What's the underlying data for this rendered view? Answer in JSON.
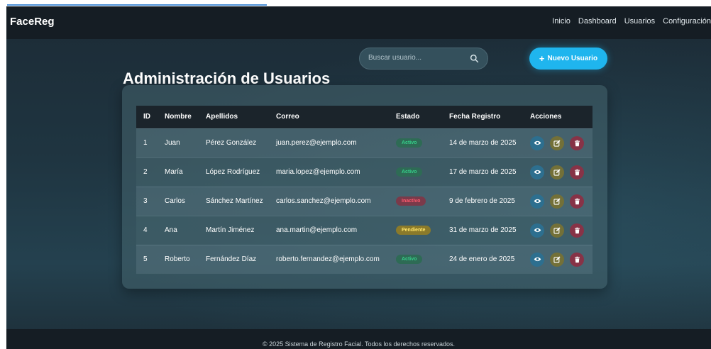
{
  "navbar": {
    "brand": "FaceReg",
    "links": [
      "Inicio",
      "Dashboard",
      "Usuarios",
      "Configuración"
    ]
  },
  "header": {
    "title": "Administración de Usuarios",
    "search_placeholder": "Buscar usuario...",
    "new_user_label": "Nuevo Usuario"
  },
  "table": {
    "columns": [
      "ID",
      "Nombre",
      "Apellidos",
      "Correo",
      "Estado",
      "Fecha Registro",
      "Acciones"
    ],
    "rows": [
      {
        "id": "1",
        "nombre": "Juan",
        "apellidos": "Pérez González",
        "correo": "juan.perez@ejemplo.com",
        "estado": "Activo",
        "fecha": "14 de marzo de 2025"
      },
      {
        "id": "2",
        "nombre": "María",
        "apellidos": "López Rodríguez",
        "correo": "maria.lopez@ejemplo.com",
        "estado": "Activo",
        "fecha": "17 de marzo de 2025"
      },
      {
        "id": "3",
        "nombre": "Carlos",
        "apellidos": "Sánchez Martínez",
        "correo": "carlos.sanchez@ejemplo.com",
        "estado": "Inactivo",
        "fecha": "9 de febrero de 2025"
      },
      {
        "id": "4",
        "nombre": "Ana",
        "apellidos": "Martín Jiménez",
        "correo": "ana.martin@ejemplo.com",
        "estado": "Pendiente",
        "fecha": "31 de marzo de 2025"
      },
      {
        "id": "5",
        "nombre": "Roberto",
        "apellidos": "Fernández Díaz",
        "correo": "roberto.fernandez@ejemplo.com",
        "estado": "Activo",
        "fecha": "24 de enero de 2025"
      }
    ]
  },
  "icons": {
    "search": "search-icon",
    "plus": "plus-icon",
    "view": "eye-icon",
    "edit": "edit-icon",
    "delete": "trash-icon"
  },
  "colors": {
    "accent": "#1fb5ee",
    "activo": "#35d08a",
    "inactivo": "#ff5a6e",
    "pendiente": "#ffe66a"
  },
  "footer": {
    "text": "© 2025 Sistema de Registro Facial. Todos los derechos reservados."
  }
}
